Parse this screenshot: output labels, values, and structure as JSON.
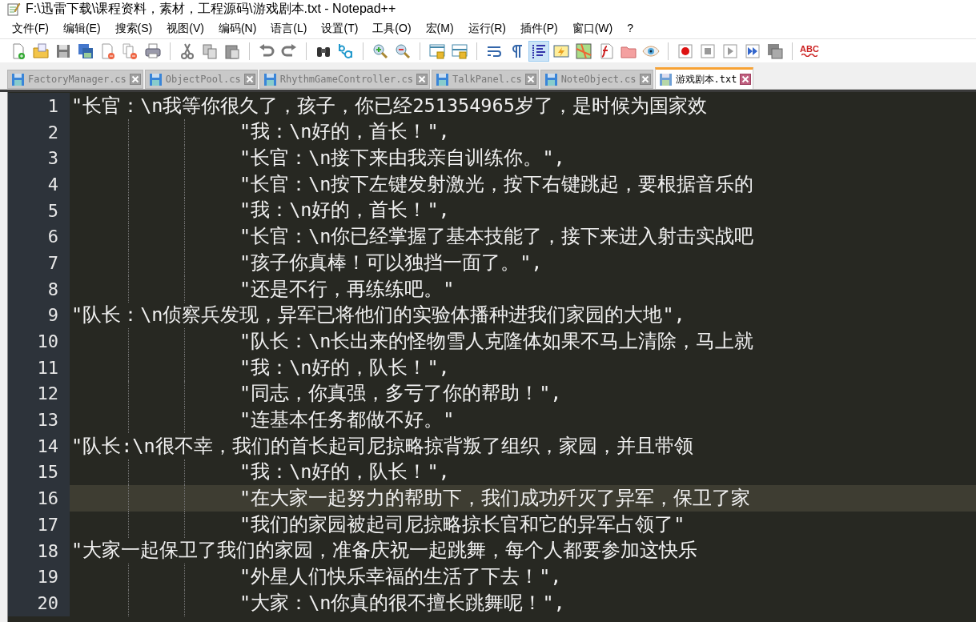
{
  "window": {
    "title": "F:\\迅雷下载\\课程资料，素材，工程源码\\游戏剧本.txt - Notepad++"
  },
  "menu": [
    "文件(F)",
    "编辑(E)",
    "搜索(S)",
    "视图(V)",
    "编码(N)",
    "语言(L)",
    "设置(T)",
    "工具(O)",
    "宏(M)",
    "运行(R)",
    "插件(P)",
    "窗口(W)",
    "?"
  ],
  "toolbar": [
    {
      "kind": "button",
      "pressed": false
    },
    {
      "kind": "button",
      "pressed": false
    },
    {
      "kind": "button",
      "pressed": false
    },
    {
      "kind": "button",
      "pressed": false
    },
    {
      "kind": "button",
      "pressed": false
    },
    {
      "kind": "button",
      "pressed": false
    },
    {
      "kind": "button",
      "pressed": false
    },
    {
      "kind": "separator"
    },
    {
      "kind": "button",
      "pressed": false
    },
    {
      "kind": "button",
      "pressed": false
    },
    {
      "kind": "button",
      "pressed": false
    },
    {
      "kind": "separator"
    },
    {
      "kind": "button",
      "pressed": false
    },
    {
      "kind": "button",
      "pressed": false
    },
    {
      "kind": "separator"
    },
    {
      "kind": "button",
      "pressed": false
    },
    {
      "kind": "button",
      "pressed": false
    },
    {
      "kind": "separator"
    },
    {
      "kind": "button",
      "pressed": false
    },
    {
      "kind": "button",
      "pressed": false
    },
    {
      "kind": "separator"
    },
    {
      "kind": "button",
      "pressed": false
    },
    {
      "kind": "button",
      "pressed": false
    },
    {
      "kind": "separator"
    },
    {
      "kind": "button",
      "pressed": false
    },
    {
      "kind": "button",
      "pressed": false
    },
    {
      "kind": "button",
      "pressed": true
    },
    {
      "kind": "button",
      "pressed": false
    },
    {
      "kind": "button",
      "pressed": false
    },
    {
      "kind": "button",
      "pressed": false
    },
    {
      "kind": "button",
      "pressed": false
    },
    {
      "kind": "button",
      "pressed": false
    },
    {
      "kind": "separator"
    },
    {
      "kind": "button",
      "pressed": false
    },
    {
      "kind": "button",
      "pressed": false
    },
    {
      "kind": "button",
      "pressed": false
    },
    {
      "kind": "button",
      "pressed": false
    },
    {
      "kind": "button",
      "pressed": false
    },
    {
      "kind": "separator"
    },
    {
      "kind": "button",
      "label": "ABC",
      "pressed": false
    }
  ],
  "tabs": [
    {
      "label": "FactoryManager.cs",
      "selected": false
    },
    {
      "label": "ObjectPool.cs",
      "selected": false
    },
    {
      "label": "RhythmGameController.cs",
      "selected": false
    },
    {
      "label": "TalkPanel.cs",
      "selected": false
    },
    {
      "label": "NoteObject.cs",
      "selected": false
    },
    {
      "label": "游戏剧本.txt",
      "selected": true
    }
  ],
  "editor": {
    "lines": [
      {
        "number": "1",
        "indented": false,
        "current": false,
        "text": "\"长官：\\n我等你很久了，孩子，你已经251354965岁了，是时候为国家效"
      },
      {
        "number": "2",
        "indented": true,
        "current": false,
        "text": "\"我：\\n好的，首长！\","
      },
      {
        "number": "3",
        "indented": true,
        "current": false,
        "text": "\"长官：\\n接下来由我亲自训练你。\","
      },
      {
        "number": "4",
        "indented": true,
        "current": false,
        "text": "\"长官：\\n按下左键发射激光，按下右键跳起，要根据音乐的"
      },
      {
        "number": "5",
        "indented": true,
        "current": false,
        "text": "\"我：\\n好的，首长！\","
      },
      {
        "number": "6",
        "indented": true,
        "current": false,
        "text": "\"长官：\\n你已经掌握了基本技能了，接下来进入射击实战吧"
      },
      {
        "number": "7",
        "indented": true,
        "current": false,
        "text": "\"孩子你真棒！可以独挡一面了。\","
      },
      {
        "number": "8",
        "indented": true,
        "current": false,
        "text": "\"还是不行，再练练吧。\""
      },
      {
        "number": "9",
        "indented": false,
        "current": false,
        "text": "\"队长：\\n侦察兵发现，异军已将他们的实验体播种进我们家园的大地\","
      },
      {
        "number": "10",
        "indented": true,
        "current": false,
        "text": "\"队长：\\n长出来的怪物雪人克隆体如果不马上清除，马上就"
      },
      {
        "number": "11",
        "indented": true,
        "current": false,
        "text": "\"我：\\n好的，队长！\","
      },
      {
        "number": "12",
        "indented": true,
        "current": false,
        "text": "\"同志，你真强，多亏了你的帮助！\","
      },
      {
        "number": "13",
        "indented": true,
        "current": false,
        "text": "\"连基本任务都做不好。\""
      },
      {
        "number": "14",
        "indented": false,
        "current": false,
        "text": "\"队长:\\n很不幸，我们的首长起司尼掠略掠背叛了组织，家园，并且带领"
      },
      {
        "number": "15",
        "indented": true,
        "current": false,
        "text": "\"我：\\n好的，队长！\","
      },
      {
        "number": "16",
        "indented": true,
        "current": true,
        "text": "\"在大家一起努力的帮助下，我们成功歼灭了异军，保卫了家"
      },
      {
        "number": "17",
        "indented": true,
        "current": false,
        "text": "\"我们的家园被起司尼掠略掠长官和它的异军占领了\""
      },
      {
        "number": "18",
        "indented": false,
        "current": false,
        "text": "\"大家一起保卫了我们的家园，准备庆祝一起跳舞，每个人都要参加这快乐"
      },
      {
        "number": "19",
        "indented": true,
        "current": false,
        "text": "\"外星人们快乐幸福的生活了下去！\","
      },
      {
        "number": "20",
        "indented": true,
        "current": false,
        "text": "\"大家：\\n你真的很不擅长跳舞呢！\","
      }
    ]
  }
}
